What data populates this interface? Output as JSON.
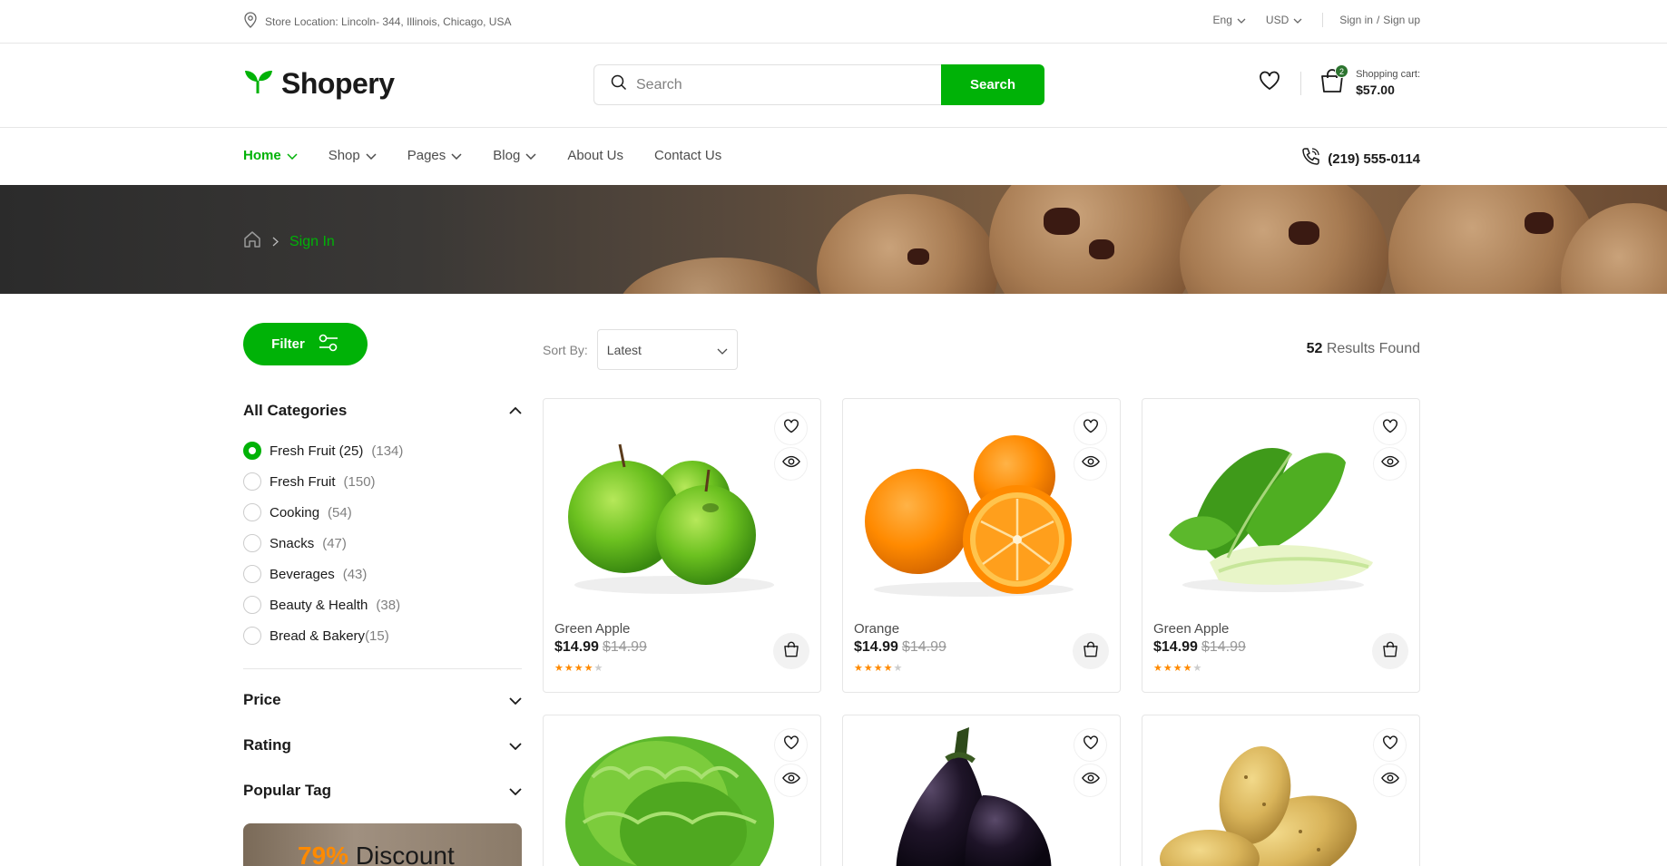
{
  "topbar": {
    "location": "Store Location: Lincoln- 344, Illinois, Chicago, USA",
    "language": "Eng",
    "currency": "USD",
    "sign_in": "Sign in",
    "sep": "/",
    "sign_up": "Sign up"
  },
  "header": {
    "logo_text": "Shopery",
    "search_placeholder": "Search",
    "search_button": "Search",
    "cart_label": "Shopping cart:",
    "cart_total": "$57.00",
    "cart_count": "2"
  },
  "nav": {
    "items": [
      {
        "label": "Home"
      },
      {
        "label": "Shop"
      },
      {
        "label": "Pages"
      },
      {
        "label": "Blog"
      },
      {
        "label": "About Us"
      },
      {
        "label": "Contact Us"
      }
    ],
    "phone": "(219) 555-0114"
  },
  "breadcrumb": {
    "current": "Sign In"
  },
  "sidebar": {
    "filter_label": "Filter",
    "categories_title": "All Categories",
    "categories": [
      {
        "label": "Fresh Fruit (25)",
        "count": "(134)"
      },
      {
        "label": "Fresh Fruit",
        "count": "(150)"
      },
      {
        "label": "Cooking",
        "count": "(54)"
      },
      {
        "label": "Snacks",
        "count": "(47)"
      },
      {
        "label": "Beverages",
        "count": "(43)"
      },
      {
        "label": "Beauty & Health",
        "count": "(38)"
      },
      {
        "label": "Bread & Bakery",
        "count": "(15)"
      }
    ],
    "price_title": "Price",
    "rating_title": "Rating",
    "tag_title": "Popular Tag",
    "promo_percent": "79%",
    "promo_text": "Discount"
  },
  "toolbar": {
    "sort_label": "Sort By:",
    "sort_value": "Latest",
    "results_count": "52",
    "results_text": "Results Found"
  },
  "products": [
    {
      "name": "Green Apple",
      "price": "$14.99",
      "old_price": "$14.99",
      "rating": 4
    },
    {
      "name": "Orange",
      "price": "$14.99",
      "old_price": "$14.99",
      "rating": 4
    },
    {
      "name": "Green Apple",
      "price": "$14.99",
      "old_price": "$14.99",
      "rating": 4
    }
  ],
  "colors": {
    "accent": "#00b207",
    "dark_green": "#2c742f",
    "star": "#ff8a00"
  }
}
